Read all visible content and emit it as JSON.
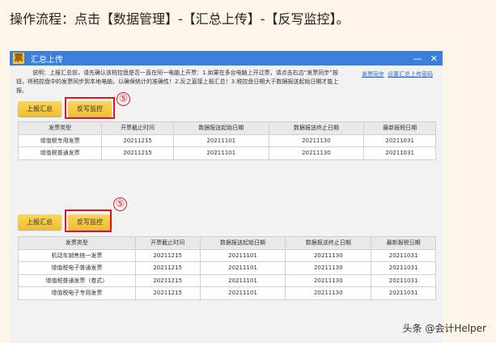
{
  "heading": "操作流程：点击【数据管理】-【汇总上传】-【反写监控】。",
  "window": {
    "title": "汇总上传",
    "logo": "票",
    "minimize": "—",
    "close": "✕"
  },
  "description": "说明：上报汇总前，请先确认该税控盘是否一直在同一电脑上开票：1.如果在多台电脑上开过票，请点击右边“发票同步”按钮，将税控盘中的发票同步到本地电脑，以确保统计的准确性！2.反之直接上报汇总！3.税控盘日期大于数据报送起始日期才能上报。",
  "links": [
    "发票同步",
    "设置汇总上传密码"
  ],
  "buttons": {
    "report": "上报汇总",
    "monitor": "反写监控"
  },
  "step_marker": "⑤",
  "columns": [
    "发票类型",
    "开票截止时间",
    "数据报送起始日期",
    "数据报送终止日期",
    "最新报税日期"
  ],
  "table1": [
    [
      "增值税专用发票",
      "20211215",
      "20211101",
      "20211130",
      "20211031"
    ],
    [
      "增值税普通发票",
      "20211215",
      "20211101",
      "20211130",
      "20211031"
    ]
  ],
  "table2": [
    [
      "机动车销售统一发票",
      "20211215",
      "20211101",
      "20211130",
      "20211031"
    ],
    [
      "增值税电子普通发票",
      "20211215",
      "20211101",
      "20211130",
      "20211031"
    ],
    [
      "增值税普通发票（卷式）",
      "20211215",
      "20211101",
      "20211130",
      "20211031"
    ],
    [
      "增值税电子专用发票",
      "20211215",
      "20211101",
      "20211130",
      "20211031"
    ]
  ],
  "watermark": "头条 @会计Helper",
  "colors": {
    "titlebar": "#3a7fdb",
    "button": "#f0be2f",
    "highlight": "#e0141e"
  }
}
